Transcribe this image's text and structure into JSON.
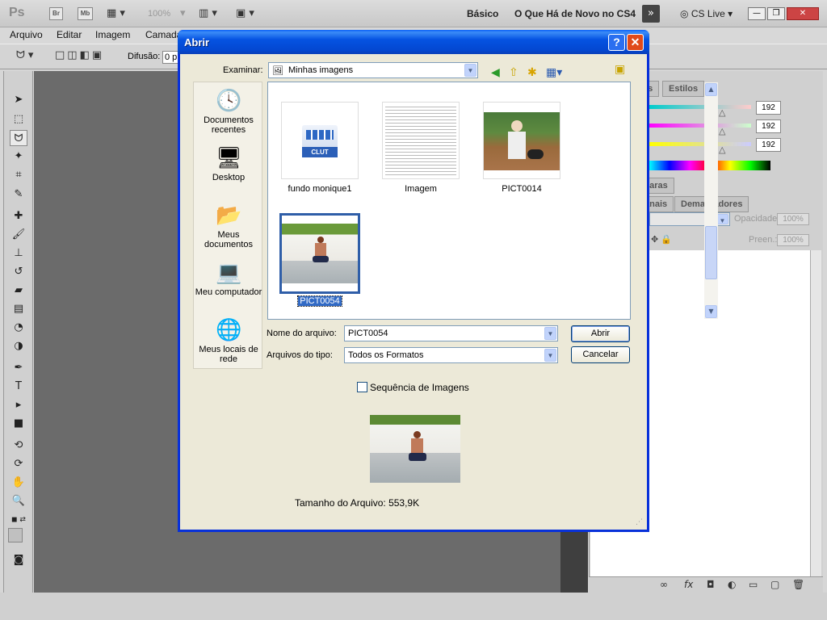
{
  "app": {
    "logo": "Ps",
    "bridge_label": "Br",
    "minibridge_label": "Mb",
    "zoom": "100%",
    "workspace_basic": "Básico",
    "workspace_new": "O Que Há de Novo no CS4",
    "cs_live": "CS Live"
  },
  "menu": [
    "Arquivo",
    "Editar",
    "Imagem",
    "Camada"
  ],
  "options": {
    "feather_label": "Difusão:",
    "feather_value": "0 p"
  },
  "panels": {
    "tab_swatches": "as",
    "tab_styles": "Estilos",
    "color_values": [
      "192",
      "192",
      "192"
    ],
    "tab_masks": "caras",
    "tab_channels": "anais",
    "tab_paths": "Demarcadores",
    "opacity_label": "Opacidade:",
    "opacity_value": "100%",
    "fill_label": "Preen.:",
    "fill_value": "100%"
  },
  "dialog": {
    "title": "Abrir",
    "lookin_label": "Examinar:",
    "lookin_value": "Minhas imagens",
    "places": [
      {
        "label": "Documentos recentes",
        "icon": "recent-documents-icon"
      },
      {
        "label": "Desktop",
        "icon": "desktop-icon"
      },
      {
        "label": "Meus documentos",
        "icon": "my-documents-icon"
      },
      {
        "label": "Meu computador",
        "icon": "my-computer-icon"
      },
      {
        "label": "Meus locais de rede",
        "icon": "network-places-icon"
      }
    ],
    "files": [
      {
        "name": "fundo monique1",
        "kind": "clut"
      },
      {
        "name": "Imagem",
        "kind": "document"
      },
      {
        "name": "PICT0014",
        "kind": "photo-outdoor"
      },
      {
        "name": "PICT0054",
        "kind": "photo-indoor",
        "selected": true
      }
    ],
    "clut_badge": "CLUT",
    "filename_label": "Nome do arquivo:",
    "filename_value": "PICT0054",
    "filetype_label": "Arquivos do tipo:",
    "filetype_value": "Todos os Formatos",
    "open_button": "Abrir",
    "cancel_button": "Cancelar",
    "sequence_label": "Sequência de Imagens",
    "filesize_text": "Tamanho do Arquivo: 553,9K"
  }
}
